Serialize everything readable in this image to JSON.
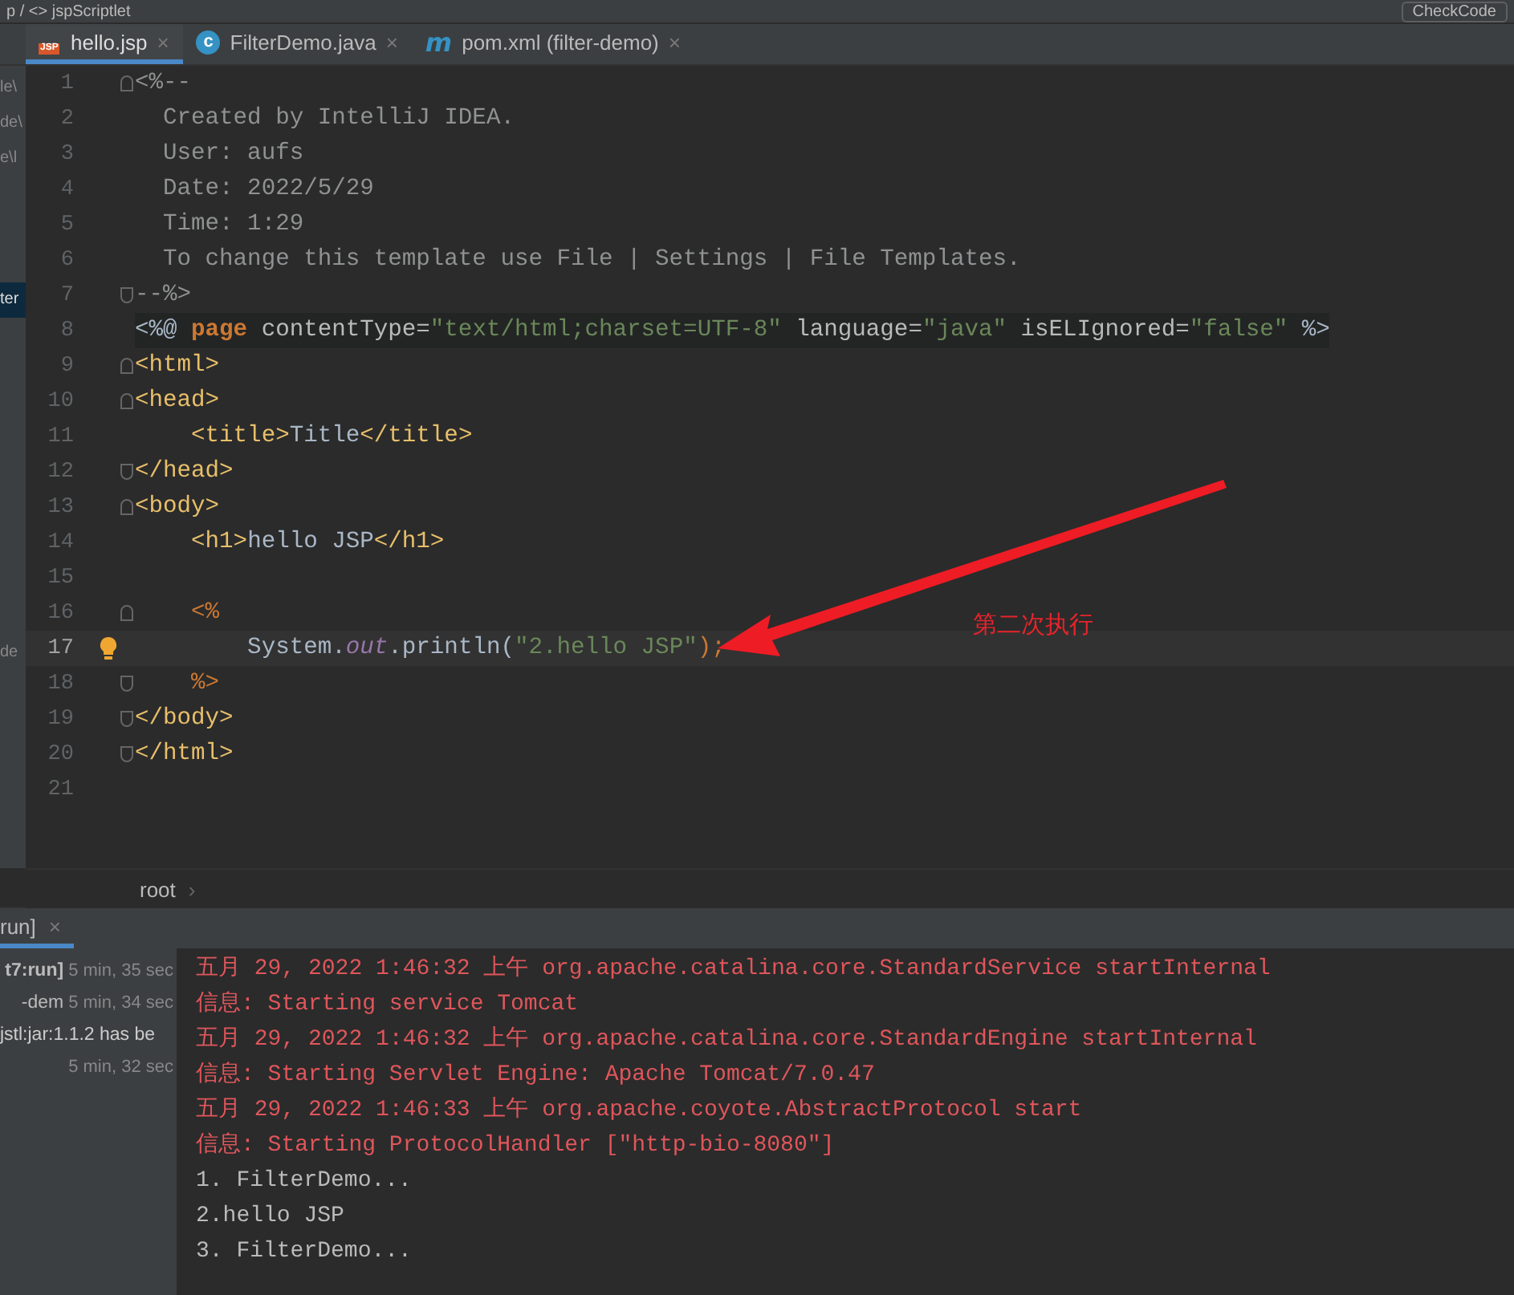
{
  "top_bar": {
    "breadcrumb": "p / <> jspScriptlet",
    "button": "CheckCode"
  },
  "tabs": [
    {
      "label": "hello.jsp",
      "kind": "jsp",
      "icon_text": "JSP",
      "close": "×",
      "selected": true
    },
    {
      "label": "FilterDemo.java",
      "kind": "class",
      "icon_text": "c",
      "close": "×",
      "selected": false
    },
    {
      "label": "pom.xml (filter-demo)",
      "kind": "maven",
      "icon_text": "m",
      "close": "×",
      "selected": false
    }
  ],
  "project_fragments": [
    {
      "text": "le\\",
      "selected": false
    },
    {
      "text": "de\\",
      "selected": false
    },
    {
      "text": "e\\l",
      "selected": false
    },
    {
      "text": "ter",
      "selected": true
    },
    {
      "text": "de",
      "selected": false
    }
  ],
  "editor": {
    "lines": [
      {
        "number": "1",
        "kind": "plain",
        "fold_start": true,
        "fold_end": false,
        "current": false,
        "bulb": false,
        "segments": [
          {
            "t": "<%--",
            "kind": "comment"
          }
        ]
      },
      {
        "number": "2",
        "kind": "plain",
        "fold_start": false,
        "fold_end": false,
        "current": false,
        "bulb": false,
        "segments": [
          {
            "t": "  Created by IntelliJ IDEA.",
            "kind": "comment"
          }
        ]
      },
      {
        "number": "3",
        "kind": "plain",
        "fold_start": false,
        "fold_end": false,
        "current": false,
        "bulb": false,
        "segments": [
          {
            "t": "  User: aufs",
            "kind": "comment"
          }
        ]
      },
      {
        "number": "4",
        "kind": "plain",
        "fold_start": false,
        "fold_end": false,
        "current": false,
        "bulb": false,
        "segments": [
          {
            "t": "  Date: 2022/5/29",
            "kind": "comment"
          }
        ]
      },
      {
        "number": "5",
        "kind": "plain",
        "fold_start": false,
        "fold_end": false,
        "current": false,
        "bulb": false,
        "segments": [
          {
            "t": "  Time: 1:29",
            "kind": "comment"
          }
        ]
      },
      {
        "number": "6",
        "kind": "plain",
        "fold_start": false,
        "fold_end": false,
        "current": false,
        "bulb": false,
        "segments": [
          {
            "t": "  To change this template use File | Settings | File Templates.",
            "kind": "comment"
          }
        ]
      },
      {
        "number": "7",
        "kind": "plain",
        "fold_start": false,
        "fold_end": true,
        "current": false,
        "bulb": false,
        "segments": [
          {
            "t": "--%>",
            "kind": "comment"
          }
        ]
      },
      {
        "number": "8",
        "kind": "directive",
        "fold_start": false,
        "fold_end": false,
        "current": false,
        "bulb": false,
        "segments": [
          {
            "t": "<%@ ",
            "kind": "plain"
          },
          {
            "t": "page ",
            "kind": "keyword"
          },
          {
            "t": "contentType=",
            "kind": "attr"
          },
          {
            "t": "\"text/html;charset=UTF-8\"",
            "kind": "string"
          },
          {
            "t": " language=",
            "kind": "attr"
          },
          {
            "t": "\"java\"",
            "kind": "string"
          },
          {
            "t": " isELIgnored=",
            "kind": "attr"
          },
          {
            "t": "\"false\"",
            "kind": "string"
          },
          {
            "t": " %>",
            "kind": "plain"
          }
        ]
      },
      {
        "number": "9",
        "kind": "plain",
        "fold_start": true,
        "fold_end": false,
        "current": false,
        "bulb": false,
        "segments": [
          {
            "t": "<html>",
            "kind": "tag"
          }
        ]
      },
      {
        "number": "10",
        "kind": "plain",
        "fold_start": true,
        "fold_end": false,
        "current": false,
        "bulb": false,
        "segments": [
          {
            "t": "<head>",
            "kind": "tag"
          }
        ]
      },
      {
        "number": "11",
        "kind": "plain",
        "fold_start": false,
        "fold_end": false,
        "current": false,
        "bulb": false,
        "segments": [
          {
            "t": "    <title>",
            "kind": "tag"
          },
          {
            "t": "Title",
            "kind": "text"
          },
          {
            "t": "</title>",
            "kind": "tag"
          }
        ]
      },
      {
        "number": "12",
        "kind": "plain",
        "fold_start": false,
        "fold_end": true,
        "current": false,
        "bulb": false,
        "segments": [
          {
            "t": "</head>",
            "kind": "tag"
          }
        ]
      },
      {
        "number": "13",
        "kind": "plain",
        "fold_start": true,
        "fold_end": false,
        "current": false,
        "bulb": false,
        "segments": [
          {
            "t": "<body>",
            "kind": "tag"
          }
        ]
      },
      {
        "number": "14",
        "kind": "plain",
        "fold_start": false,
        "fold_end": false,
        "current": false,
        "bulb": false,
        "segments": [
          {
            "t": "    <h1>",
            "kind": "tag"
          },
          {
            "t": "hello JSP",
            "kind": "text"
          },
          {
            "t": "</h1>",
            "kind": "tag"
          }
        ]
      },
      {
        "number": "15",
        "kind": "plain",
        "fold_start": false,
        "fold_end": false,
        "current": false,
        "bulb": false
      },
      {
        "number": "16",
        "kind": "scriptlet",
        "fold_start": true,
        "fold_end": false,
        "current": false,
        "bulb": false,
        "segments": [
          {
            "t": "    <%",
            "kind": "delim"
          }
        ]
      },
      {
        "number": "17",
        "kind": "scriptlet",
        "fold_start": false,
        "fold_end": false,
        "current": true,
        "bulb": true,
        "segments": [
          {
            "t": "        System.",
            "kind": "text"
          },
          {
            "t": "out",
            "kind": "field"
          },
          {
            "t": ".println(",
            "kind": "text"
          },
          {
            "t": "\"2.hello JSP\"",
            "kind": "string"
          },
          {
            "t": ");",
            "kind": "semi"
          }
        ]
      },
      {
        "number": "18",
        "kind": "scriptlet",
        "fold_start": false,
        "fold_end": true,
        "current": false,
        "bulb": false,
        "segments": [
          {
            "t": "    %>",
            "kind": "delim"
          }
        ]
      },
      {
        "number": "19",
        "kind": "plain",
        "fold_start": false,
        "fold_end": true,
        "current": false,
        "bulb": false,
        "segments": [
          {
            "t": "</body>",
            "kind": "tag"
          }
        ]
      },
      {
        "number": "20",
        "kind": "plain",
        "fold_start": false,
        "fold_end": true,
        "current": false,
        "bulb": false,
        "segments": [
          {
            "t": "</html>",
            "kind": "tag"
          }
        ]
      },
      {
        "number": "21",
        "kind": "plain",
        "fold_start": false,
        "fold_end": false,
        "current": false,
        "bulb": false
      }
    ],
    "breadcrumb": "root",
    "breadcrumb_sep": "›"
  },
  "annotation": {
    "text": "第二次执行"
  },
  "run_panel": {
    "tab": "run]",
    "tab_close": "×",
    "tree": [
      {
        "name": "t7:run]",
        "time": "5 min, 35 sec",
        "kind": "root"
      },
      {
        "name": "-dem",
        "time": "5 min, 34 sec",
        "kind": "task"
      },
      {
        "name": "jstl:jar:1.1.2 has be",
        "kind": "message"
      },
      {
        "time": "5 min, 32 sec",
        "kind": "task"
      }
    ],
    "console": [
      {
        "text": "五月 29, 2022 1:46:32 上午 org.apache.catalina.core.StandardService startInternal",
        "kind": "error"
      },
      {
        "text": "信息: Starting service Tomcat",
        "kind": "error"
      },
      {
        "text": "五月 29, 2022 1:46:32 上午 org.apache.catalina.core.StandardEngine startInternal",
        "kind": "error"
      },
      {
        "text": "信息: Starting Servlet Engine: Apache Tomcat/7.0.47",
        "kind": "error"
      },
      {
        "text": "五月 29, 2022 1:46:33 上午 org.apache.coyote.AbstractProtocol start",
        "kind": "error"
      },
      {
        "text": "信息: Starting ProtocolHandler [\"http-bio-8080\"]",
        "kind": "error"
      },
      {
        "text": "1. FilterDemo...",
        "kind": "output"
      },
      {
        "text": "2.hello JSP",
        "kind": "output"
      },
      {
        "text": "3. FilterDemo...",
        "kind": "output"
      }
    ]
  }
}
